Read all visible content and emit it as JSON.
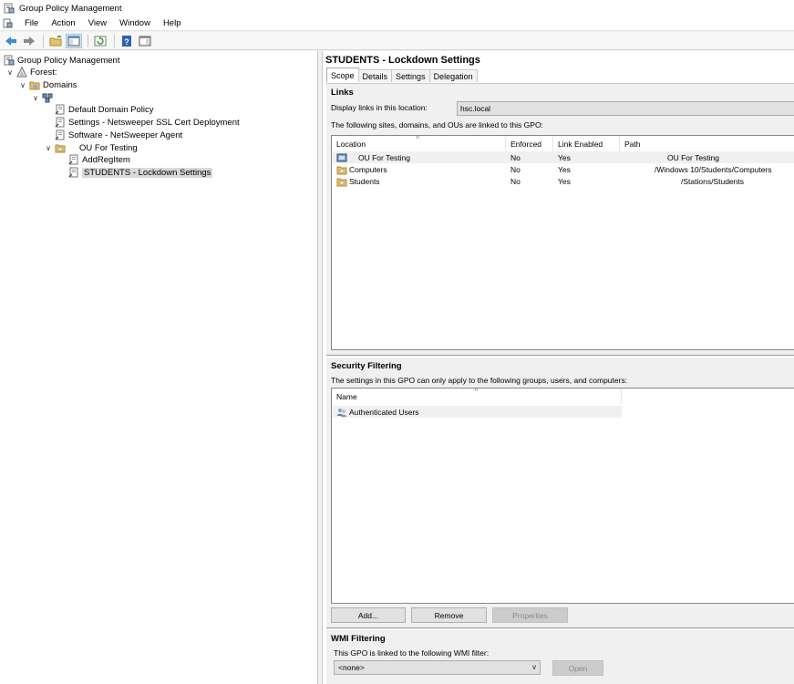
{
  "window": {
    "title": "Group Policy Management"
  },
  "menu": [
    "File",
    "Action",
    "View",
    "Window",
    "Help"
  ],
  "toolbar": [
    "back-arrow-icon",
    "forward-arrow-icon",
    "up-folder-icon",
    "show-hide-tree-icon",
    "refresh-icon",
    "help-icon",
    "properties-pane-icon"
  ],
  "tree": {
    "root": "Group Policy Management",
    "forest": "Forest:",
    "domains": "Domains",
    "domain": "",
    "items": [
      {
        "label": "Default Domain Policy"
      },
      {
        "label": "Settings - Netsweeper SSL Cert Deployment"
      },
      {
        "label": "Software - NetSweeper Agent"
      }
    ],
    "ou": "OU For Testing",
    "ou_children": [
      {
        "label": "AddRegItem"
      },
      {
        "label": "STUDENTS - Lockdown Settings"
      }
    ]
  },
  "details": {
    "title": "STUDENTS - Lockdown Settings",
    "tabs": [
      "Scope",
      "Details",
      "Settings",
      "Delegation"
    ],
    "links": {
      "heading": "Links",
      "display_label": "Display links in this location:",
      "display_value": "hsc.local",
      "desc": "The following sites, domains, and OUs are linked to this GPO:",
      "columns": [
        "Location",
        "Enforced",
        "Link Enabled",
        "Path"
      ],
      "rows": [
        {
          "location": "OU For Testing",
          "enforced": "No",
          "enabled": "Yes",
          "path": "OU For Testing"
        },
        {
          "location": "Computers",
          "enforced": "No",
          "enabled": "Yes",
          "path": "/Windows 10/Students/Computers"
        },
        {
          "location": "Students",
          "enforced": "No",
          "enabled": "Yes",
          "path": "/Stations/Students"
        }
      ]
    },
    "security": {
      "heading": "Security Filtering",
      "desc": "The settings in this GPO can only apply to the following groups, users, and computers:",
      "column": "Name",
      "rows": [
        "Authenticated Users"
      ],
      "buttons": {
        "add": "Add...",
        "remove": "Remove",
        "properties": "Properties"
      }
    },
    "wmi": {
      "heading": "WMI Filtering",
      "desc": "This GPO is linked to the following WMI filter:",
      "value": "<none>",
      "open": "Open"
    }
  }
}
